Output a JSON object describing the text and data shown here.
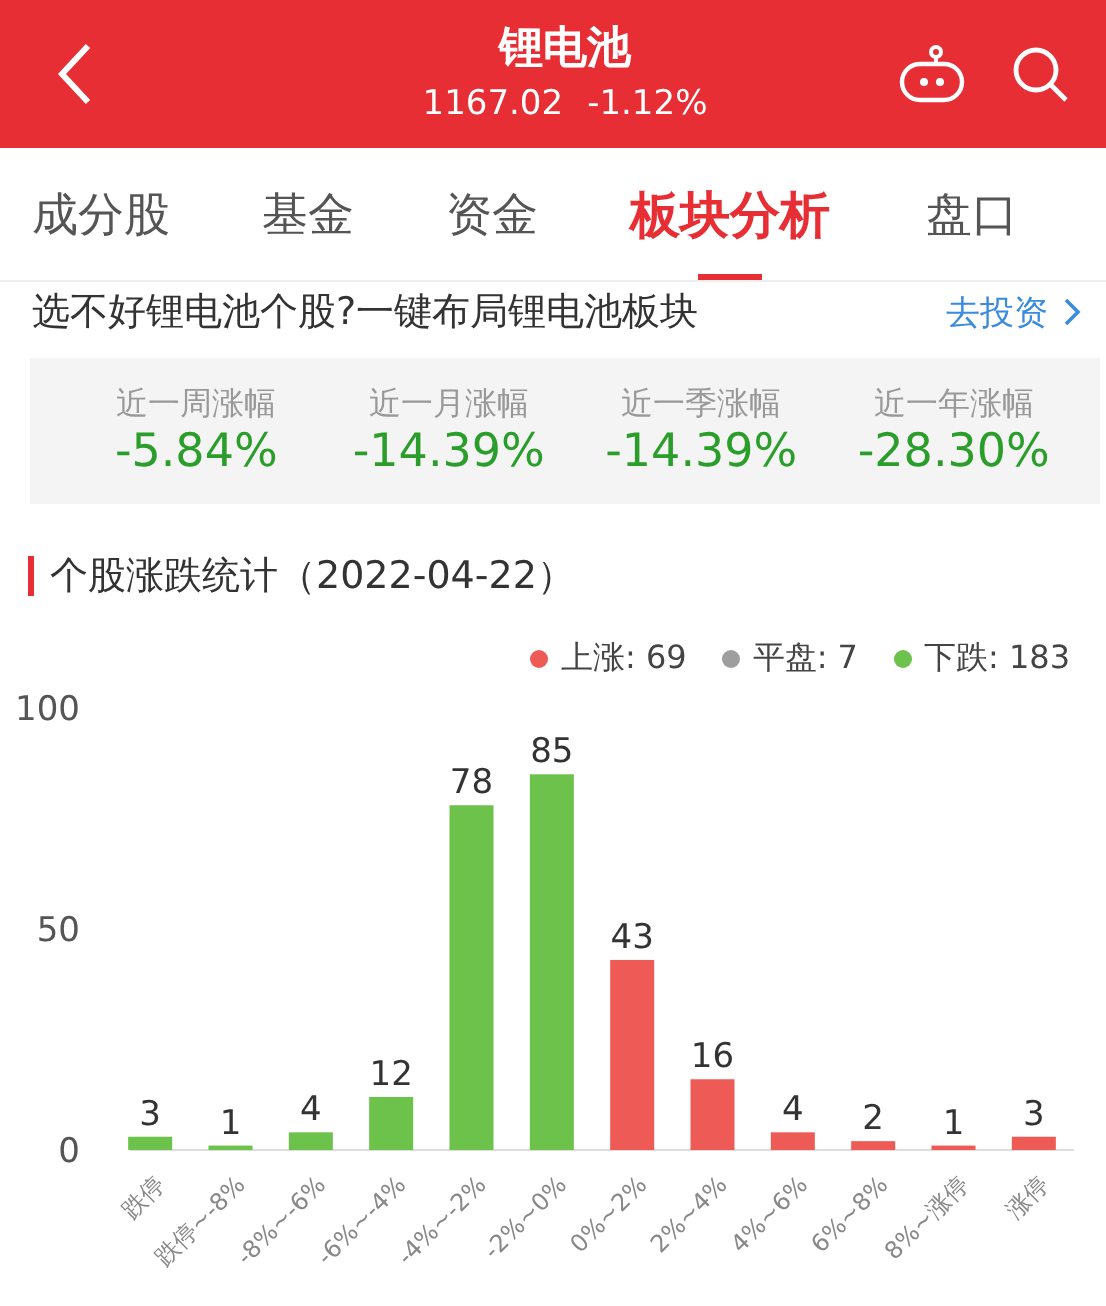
{
  "header": {
    "title": "锂电池",
    "price": "1167.02",
    "change": "-1.12%"
  },
  "tabs": [
    {
      "label": "成分股",
      "selected": false
    },
    {
      "label": "基金",
      "selected": false
    },
    {
      "label": "资金",
      "selected": false
    },
    {
      "label": "板块分析",
      "selected": true
    },
    {
      "label": "盘口",
      "selected": false
    }
  ],
  "promo": {
    "text": "选不好锂电池个股?一键布局锂电池板块",
    "link": "去投资"
  },
  "stats": [
    {
      "label": "近一周涨幅",
      "value": "-5.84%"
    },
    {
      "label": "近一月涨幅",
      "value": "-14.39%"
    },
    {
      "label": "近一季涨幅",
      "value": "-14.39%"
    },
    {
      "label": "近一年涨幅",
      "value": "-28.30%"
    }
  ],
  "section_title": "个股涨跌统计（2022-04-22）",
  "legend": [
    {
      "label": "上涨: 69",
      "color": "#ee5b56"
    },
    {
      "label": "平盘: 7",
      "color": "#9e9e9e"
    },
    {
      "label": "下跌: 183",
      "color": "#6cc24a"
    }
  ],
  "chart_data": {
    "type": "bar",
    "categories": [
      "跌停",
      "跌停~-8%",
      "-8%~-6%",
      "-6%~-4%",
      "-4%~-2%",
      "-2%~0%",
      "0%~2%",
      "2%~4%",
      "4%~6%",
      "6%~8%",
      "8%~涨停",
      "涨停"
    ],
    "series": [
      {
        "color": "#6cc24a",
        "values": [
          3,
          1,
          4,
          12,
          78,
          85,
          null,
          null,
          null,
          null,
          null,
          null
        ]
      },
      {
        "color": "#ee5b56",
        "values": [
          null,
          null,
          null,
          null,
          null,
          null,
          43,
          16,
          4,
          2,
          1,
          3
        ]
      }
    ],
    "ylim": [
      0,
      100
    ],
    "yticks": [
      0,
      50,
      100
    ],
    "data_labels": true
  }
}
